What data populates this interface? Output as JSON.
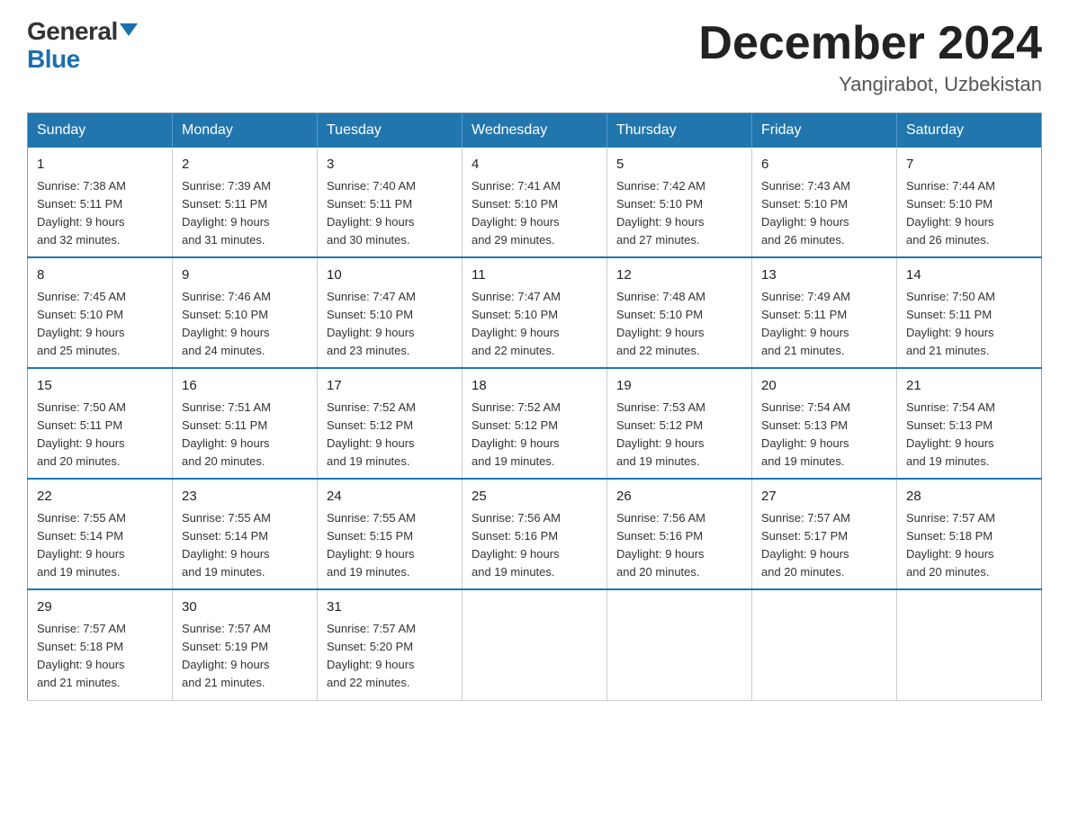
{
  "logo": {
    "general": "General",
    "blue": "Blue",
    "triangle": true
  },
  "title": "December 2024",
  "subtitle": "Yangirabot, Uzbekistan",
  "days_of_week": [
    "Sunday",
    "Monday",
    "Tuesday",
    "Wednesday",
    "Thursday",
    "Friday",
    "Saturday"
  ],
  "weeks": [
    [
      {
        "day": "1",
        "sunrise": "7:38 AM",
        "sunset": "5:11 PM",
        "daylight": "9 hours and 32 minutes."
      },
      {
        "day": "2",
        "sunrise": "7:39 AM",
        "sunset": "5:11 PM",
        "daylight": "9 hours and 31 minutes."
      },
      {
        "day": "3",
        "sunrise": "7:40 AM",
        "sunset": "5:11 PM",
        "daylight": "9 hours and 30 minutes."
      },
      {
        "day": "4",
        "sunrise": "7:41 AM",
        "sunset": "5:10 PM",
        "daylight": "9 hours and 29 minutes."
      },
      {
        "day": "5",
        "sunrise": "7:42 AM",
        "sunset": "5:10 PM",
        "daylight": "9 hours and 27 minutes."
      },
      {
        "day": "6",
        "sunrise": "7:43 AM",
        "sunset": "5:10 PM",
        "daylight": "9 hours and 26 minutes."
      },
      {
        "day": "7",
        "sunrise": "7:44 AM",
        "sunset": "5:10 PM",
        "daylight": "9 hours and 26 minutes."
      }
    ],
    [
      {
        "day": "8",
        "sunrise": "7:45 AM",
        "sunset": "5:10 PM",
        "daylight": "9 hours and 25 minutes."
      },
      {
        "day": "9",
        "sunrise": "7:46 AM",
        "sunset": "5:10 PM",
        "daylight": "9 hours and 24 minutes."
      },
      {
        "day": "10",
        "sunrise": "7:47 AM",
        "sunset": "5:10 PM",
        "daylight": "9 hours and 23 minutes."
      },
      {
        "day": "11",
        "sunrise": "7:47 AM",
        "sunset": "5:10 PM",
        "daylight": "9 hours and 22 minutes."
      },
      {
        "day": "12",
        "sunrise": "7:48 AM",
        "sunset": "5:10 PM",
        "daylight": "9 hours and 22 minutes."
      },
      {
        "day": "13",
        "sunrise": "7:49 AM",
        "sunset": "5:11 PM",
        "daylight": "9 hours and 21 minutes."
      },
      {
        "day": "14",
        "sunrise": "7:50 AM",
        "sunset": "5:11 PM",
        "daylight": "9 hours and 21 minutes."
      }
    ],
    [
      {
        "day": "15",
        "sunrise": "7:50 AM",
        "sunset": "5:11 PM",
        "daylight": "9 hours and 20 minutes."
      },
      {
        "day": "16",
        "sunrise": "7:51 AM",
        "sunset": "5:11 PM",
        "daylight": "9 hours and 20 minutes."
      },
      {
        "day": "17",
        "sunrise": "7:52 AM",
        "sunset": "5:12 PM",
        "daylight": "9 hours and 19 minutes."
      },
      {
        "day": "18",
        "sunrise": "7:52 AM",
        "sunset": "5:12 PM",
        "daylight": "9 hours and 19 minutes."
      },
      {
        "day": "19",
        "sunrise": "7:53 AM",
        "sunset": "5:12 PM",
        "daylight": "9 hours and 19 minutes."
      },
      {
        "day": "20",
        "sunrise": "7:54 AM",
        "sunset": "5:13 PM",
        "daylight": "9 hours and 19 minutes."
      },
      {
        "day": "21",
        "sunrise": "7:54 AM",
        "sunset": "5:13 PM",
        "daylight": "9 hours and 19 minutes."
      }
    ],
    [
      {
        "day": "22",
        "sunrise": "7:55 AM",
        "sunset": "5:14 PM",
        "daylight": "9 hours and 19 minutes."
      },
      {
        "day": "23",
        "sunrise": "7:55 AM",
        "sunset": "5:14 PM",
        "daylight": "9 hours and 19 minutes."
      },
      {
        "day": "24",
        "sunrise": "7:55 AM",
        "sunset": "5:15 PM",
        "daylight": "9 hours and 19 minutes."
      },
      {
        "day": "25",
        "sunrise": "7:56 AM",
        "sunset": "5:16 PM",
        "daylight": "9 hours and 19 minutes."
      },
      {
        "day": "26",
        "sunrise": "7:56 AM",
        "sunset": "5:16 PM",
        "daylight": "9 hours and 20 minutes."
      },
      {
        "day": "27",
        "sunrise": "7:57 AM",
        "sunset": "5:17 PM",
        "daylight": "9 hours and 20 minutes."
      },
      {
        "day": "28",
        "sunrise": "7:57 AM",
        "sunset": "5:18 PM",
        "daylight": "9 hours and 20 minutes."
      }
    ],
    [
      {
        "day": "29",
        "sunrise": "7:57 AM",
        "sunset": "5:18 PM",
        "daylight": "9 hours and 21 minutes."
      },
      {
        "day": "30",
        "sunrise": "7:57 AM",
        "sunset": "5:19 PM",
        "daylight": "9 hours and 21 minutes."
      },
      {
        "day": "31",
        "sunrise": "7:57 AM",
        "sunset": "5:20 PM",
        "daylight": "9 hours and 22 minutes."
      },
      null,
      null,
      null,
      null
    ]
  ],
  "labels": {
    "sunrise": "Sunrise:",
    "sunset": "Sunset:",
    "daylight": "Daylight:"
  }
}
